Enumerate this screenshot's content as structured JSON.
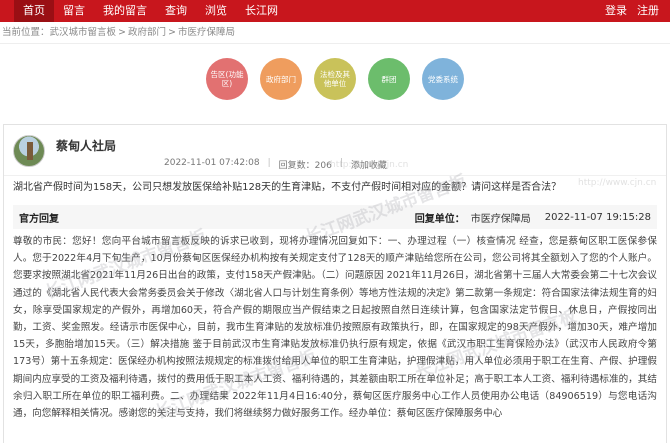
{
  "nav": {
    "items": [
      "首页",
      "留言",
      "我的留言",
      "查询",
      "浏览",
      "长江网"
    ],
    "right": [
      "登录",
      "注册"
    ]
  },
  "breadcrumb": {
    "prefix": "当前位置：",
    "items": [
      "武汉城市留言板",
      "政府部门",
      "市医疗保障局"
    ]
  },
  "categories": [
    {
      "label": "告区(功能区)",
      "color": "#e27171"
    },
    {
      "label": "政府部门",
      "color": "#ef9d5e"
    },
    {
      "label": "法检及其他单位",
      "color": "#c9c25a"
    },
    {
      "label": "群团",
      "color": "#6cbd6c"
    },
    {
      "label": "党委系统",
      "color": "#7fb3db"
    }
  ],
  "post": {
    "author": "蔡甸人社局",
    "time": "2022-11-01 07:42:08",
    "views_label": "回复数：206",
    "favorite": "添加收藏",
    "question": "湖北省产假时间为158天，公司只想发放医保给补贴128天的生育津贴，不支付产假时间相对应的金额？请问这样是否合法？"
  },
  "reply": {
    "title": "官方回复",
    "unit_label": "回复单位：",
    "unit": "市医疗保障局",
    "date": "2022-11-07 19:15:28",
    "body": "尊敬的市民：您好！您向平台城市留言板反映的诉求已收到，现将办理情况回复如下：一、办理过程（一）核查情况 经查，您是蔡甸区职工医保参保人。您于2022年4月下旬生产，10月份蔡甸区医保经办机构按有关规定支付了128天的顺产津贴给您所在公司，您公司将其全额划入了您的个人账户。您要求按照湖北省2021年11月26日出台的政策，支付158天产假津贴。（二）问题原因 2021年11月26日，湖北省第十三届人大常委会第二十七次会议通过的《湖北省人民代表大会常务委员会关于修改〈湖北省人口与计划生育条例〉等地方性法规的决定》第二款第一条规定：符合国家法律法规生育的妇女，除享受国家规定的产假外，再增加60天，符合产假的期限应当产假结束之日起按照自然日连续计算，包含国家法定节假日、休息日，产假按同出勤，工资、奖金照发。经请示市医保中心，目前，我市生育津贴的发放标准仍按照原有政策执行，即，在国家规定的98天产假外，增加30天，难产增加15天，多胞胎增加15天。（三）解决措施 鉴于目前武汉市生育津贴发放标准仍执行原有规定，依据《武汉市职工生育保险办法》（武汉市人民政府令第173号）第十五条规定：医保经办机构按照法规规定的标准拨付给用人单位的职工生育津贴，护理假津贴，用人单位必须用于职工在生育、产假、护理假期间内应享受的工资及福利待遇，拨付的费用低于职工本人工资、福利待遇的，其差额由职工所在单位补足；高于职工本人工资、福利待遇标准的，其结余归入职工所在单位的职工福利费。二、办理结果 2022年11月4日16:40分，蔡甸区医疗服务中心工作人员使用办公电话（84906519）与您电话沟通，向您解释相关情况。感谢您的关注与支持，我们将继续努力做好服务工作。经办单位：蔡甸区医疗保障服务中心"
  },
  "watermark": {
    "text": "长江网武汉城市留言板",
    "url": "http://www.cjn.cn"
  }
}
